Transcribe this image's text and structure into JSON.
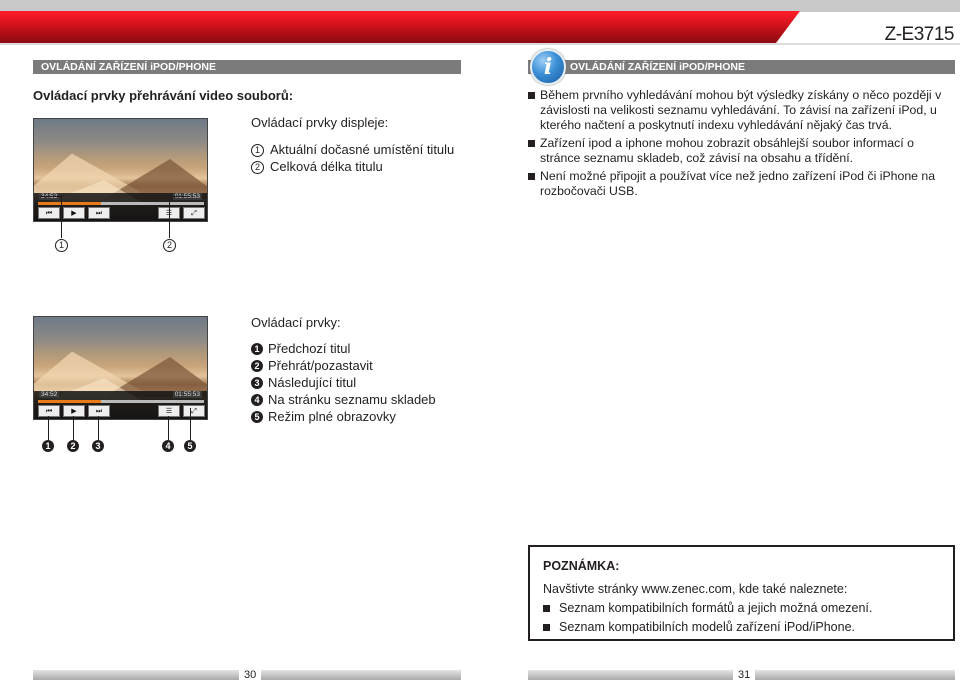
{
  "header": {
    "model": "Z-E3715"
  },
  "left": {
    "section_title": "OVLÁDÁNÍ ZAŘÍZENÍ iPOD/PHONE",
    "heading": "Ovládací prvky přehrávání video souborů:",
    "display": {
      "label": "Ovládací prvky displeje:",
      "items": [
        {
          "num": "1",
          "text": "Aktuální dočasné umístění titulu"
        },
        {
          "num": "2",
          "text": "Celková délka titulu"
        }
      ]
    },
    "controls": {
      "label": "Ovládací prvky:",
      "items": [
        {
          "num": "1",
          "text": "Předchozí titul"
        },
        {
          "num": "2",
          "text": "Přehrát/pozastavit"
        },
        {
          "num": "3",
          "text": "Následující titul"
        },
        {
          "num": "4",
          "text": "Na stránku seznamu skladeb"
        },
        {
          "num": "5",
          "text": "Režim plné obrazovky"
        }
      ]
    },
    "video": {
      "elapsed": "34:52",
      "total": "01:55:53",
      "progress": 0.38,
      "prev_icon": "⏮",
      "play_icon": "▶",
      "next_icon": "⏭",
      "list_icon": "☰",
      "fullscreen_icon": "⤢"
    },
    "callouts_top": [
      "1",
      "2"
    ],
    "callouts_bottom": [
      "1",
      "2",
      "3",
      "4",
      "5"
    ]
  },
  "right": {
    "section_title": "OVLÁDÁNÍ ZAŘÍZENÍ iPOD/PHONE",
    "info_icon": "i",
    "bullets": [
      "Během prvního vyhledávání mohou být výsledky získány o něco později v závislosti na velikosti seznamu vyhledávání. To závisí na zařízení iPod, u kterého načtení a poskytnutí indexu vyhledávání nějaký čas trvá.",
      "Zařízení ipod a iphone mohou zobrazit obsáhlejší soubor informací o stránce seznamu skladeb, což závisí na obsahu a třídění.",
      "Není možné připojit a používat více než jedno zařízení iPod či iPhone na rozbočovači USB."
    ],
    "note": {
      "title": "POZNÁMKA:",
      "intro": "Navštivte stránky www.zenec.com, kde také naleznete:",
      "items": [
        "Seznam kompatibilních formátů a jejich možná omezení.",
        "Seznam kompatibilních modelů zařízení iPod/iPhone."
      ]
    }
  },
  "footer": {
    "page_left": "30",
    "page_right": "31"
  }
}
